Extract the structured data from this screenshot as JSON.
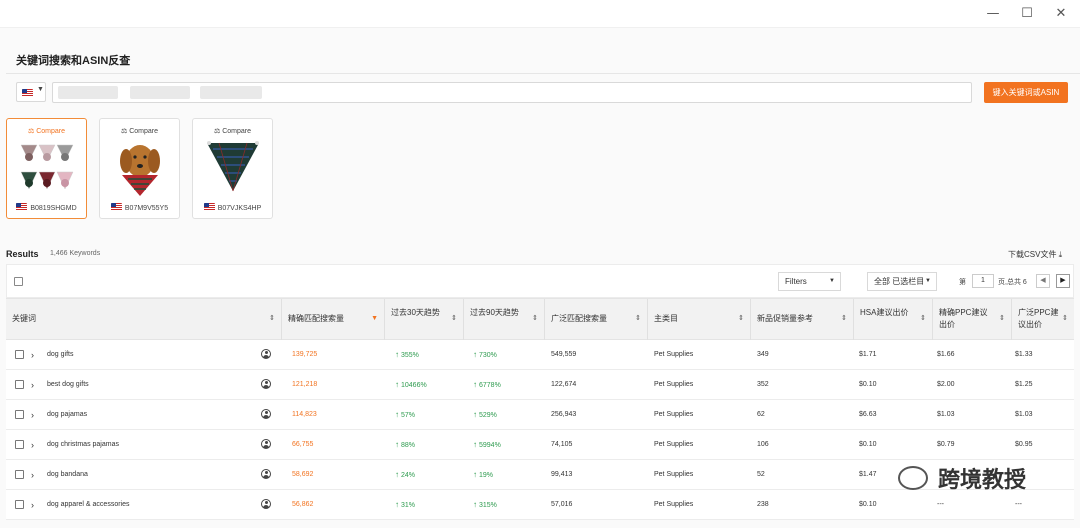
{
  "window": {
    "minimize": "—",
    "maximize": "☐",
    "close": "✕"
  },
  "panel": {
    "title": "关键词搜索和ASIN反查"
  },
  "search": {
    "country": "us-flag",
    "value": "",
    "button_label": "键入关键词或ASIN"
  },
  "compare_cards": [
    {
      "compare_label": "Compare",
      "asin": "B0819SHGMD",
      "active": true
    },
    {
      "compare_label": "Compare",
      "asin": "B07M9V55Y5",
      "active": false
    },
    {
      "compare_label": "Compare",
      "asin": "B07VJKS4HP",
      "active": false
    }
  ],
  "results": {
    "label": "Results",
    "count": "1,466 Keywords",
    "download": "下载CSV文件 ⤓"
  },
  "toolbar": {
    "filters": "Filters",
    "columns": "全部 已选栏目",
    "page_pre": "第",
    "page_value": "1",
    "page_post": "页,总共 6",
    "prev": "◀",
    "next": "▶"
  },
  "table": {
    "headers": [
      "关键词",
      "精确匹配搜索量",
      "过去30天趋势",
      "过去90天趋势",
      "广泛匹配搜索量",
      "主类目",
      "新品促销量参考",
      "HSA建议出价",
      "精确PPC建议出价",
      "广泛PPC建议出价"
    ],
    "rows": [
      {
        "keyword": "dog gifts",
        "exact": "139,725",
        "t30": "355%",
        "t90": "730%",
        "broad": "549,559",
        "category": "Pet Supplies",
        "promo": "349",
        "hsa": "$1.71",
        "ppc_exact": "$1.66",
        "ppc_broad": "$1.33"
      },
      {
        "keyword": "best dog gifts",
        "exact": "121,218",
        "t30": "10466%",
        "t90": "6778%",
        "broad": "122,674",
        "category": "Pet Supplies",
        "promo": "352",
        "hsa": "$0.10",
        "ppc_exact": "$2.00",
        "ppc_broad": "$1.25"
      },
      {
        "keyword": "dog pajamas",
        "exact": "114,823",
        "t30": "57%",
        "t90": "529%",
        "broad": "256,943",
        "category": "Pet Supplies",
        "promo": "62",
        "hsa": "$6.63",
        "ppc_exact": "$1.03",
        "ppc_broad": "$1.03"
      },
      {
        "keyword": "dog christmas pajamas",
        "exact": "66,755",
        "t30": "88%",
        "t90": "5994%",
        "broad": "74,105",
        "category": "Pet Supplies",
        "promo": "106",
        "hsa": "$0.10",
        "ppc_exact": "$0.79",
        "ppc_broad": "$0.95"
      },
      {
        "keyword": "dog bandana",
        "exact": "58,692",
        "t30": "24%",
        "t90": "19%",
        "broad": "99,413",
        "category": "Pet Supplies",
        "promo": "52",
        "hsa": "$1.47",
        "ppc_exact": "",
        "ppc_broad": ""
      },
      {
        "keyword": "dog apparel & accessories",
        "exact": "56,862",
        "t30": "31%",
        "t90": "315%",
        "broad": "57,016",
        "category": "Pet Supplies",
        "promo": "238",
        "hsa": "$0.10",
        "ppc_exact": "---",
        "ppc_broad": "---"
      }
    ]
  },
  "watermark": {
    "text": "跨境教授"
  },
  "colors": {
    "accent": "#f27320",
    "trend_up": "#2e9b4f"
  }
}
